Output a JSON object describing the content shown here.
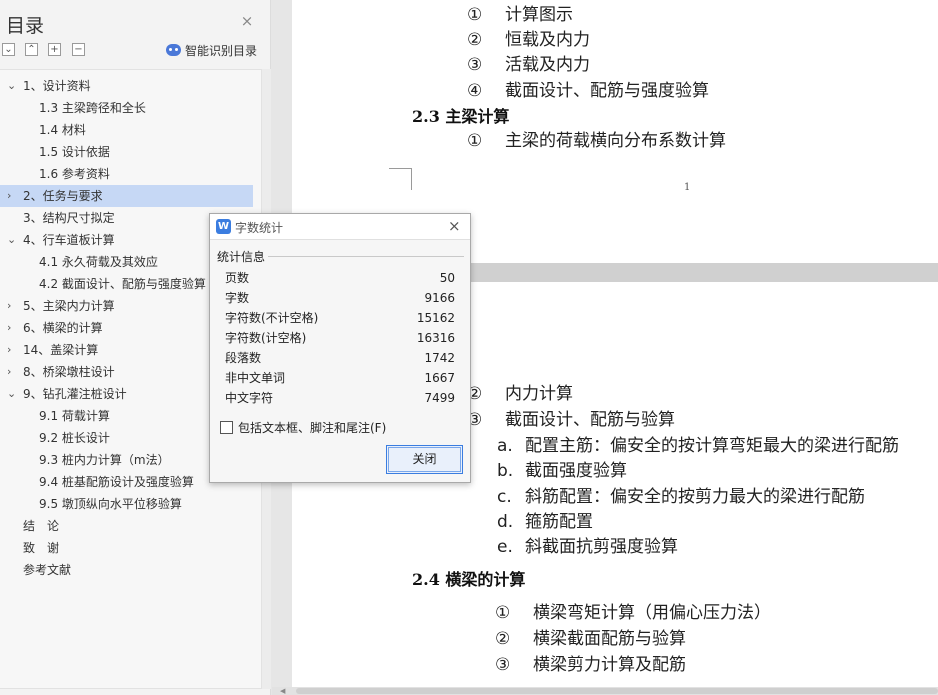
{
  "toc": {
    "title": "目录",
    "close_glyph": "×",
    "tools": {
      "collapse_all": "⌄",
      "expand_up": "⌃",
      "add": "+",
      "remove": "−",
      "smart_label": "智能识别目录"
    },
    "items": [
      {
        "label": "1、设计资料",
        "level": 1,
        "chevron": "⌄"
      },
      {
        "label": "1.3 主梁跨径和全长",
        "level": 2
      },
      {
        "label": "1.4 材料",
        "level": 2
      },
      {
        "label": "1.5 设计依据",
        "level": 2
      },
      {
        "label": "1.6 参考资料",
        "level": 2
      },
      {
        "label": "2、任务与要求",
        "level": 1,
        "chevron": "›",
        "selected": true
      },
      {
        "label": "3、结构尺寸拟定",
        "level": 1
      },
      {
        "label": "4、行车道板计算",
        "level": 1,
        "chevron": "⌄"
      },
      {
        "label": "4.1 永久荷载及其效应",
        "level": 2
      },
      {
        "label": "4.2 截面设计、配筋与强度验算",
        "level": 2
      },
      {
        "label": "5、主梁内力计算",
        "level": 1,
        "chevron": "›"
      },
      {
        "label": "6、横梁的计算",
        "level": 1,
        "chevron": "›"
      },
      {
        "label": "14、盖梁计算",
        "level": 1,
        "chevron": "›"
      },
      {
        "label": "8、桥梁墩柱设计",
        "level": 1,
        "chevron": "›"
      },
      {
        "label": "9、钻孔灌注桩设计",
        "level": 1,
        "chevron": "⌄"
      },
      {
        "label": "9.1 荷载计算",
        "level": 2
      },
      {
        "label": "9.2 桩长设计",
        "level": 2
      },
      {
        "label": "9.3 桩内力计算（m法）",
        "level": 2
      },
      {
        "label": "9.4 桩基配筋设计及强度验算",
        "level": 2
      },
      {
        "label": "9.5 墩顶纵向水平位移验算",
        "level": 2
      },
      {
        "label": "结　论",
        "level": 1
      },
      {
        "label": "致　谢",
        "level": 1
      },
      {
        "label": "参考文献",
        "level": 1
      }
    ]
  },
  "doc": {
    "page1": {
      "lines": [
        {
          "num": "①",
          "text": "计算图示"
        },
        {
          "num": "②",
          "text": "恒载及内力"
        },
        {
          "num": "③",
          "text": "活载及内力"
        },
        {
          "num": "④",
          "text": "截面设计、配筋与强度验算"
        }
      ],
      "heading": "2.3 主梁计算",
      "heading_line": {
        "num": "①",
        "text": "主梁的荷载横向分布系数计算"
      },
      "page_number": "1"
    },
    "page2": {
      "lines": [
        {
          "num": "②",
          "text": "内力计算"
        },
        {
          "num": "③",
          "text": "截面设计、配筋与验算"
        }
      ],
      "sub_items": [
        {
          "num": "a.",
          "text": "配置主筋：偏安全的按计算弯矩最大的梁进行配筋"
        },
        {
          "num": "b.",
          "text": "截面强度验算"
        },
        {
          "num": "c.",
          "text": "斜筋配置：偏安全的按剪力最大的梁进行配筋"
        },
        {
          "num": "d.",
          "text": "箍筋配置"
        },
        {
          "num": "e.",
          "text": "斜截面抗剪强度验算"
        }
      ],
      "heading": "2.4 横梁的计算",
      "heading_lines": [
        {
          "num": "①",
          "text": "横梁弯矩计算（用偏心压力法）"
        },
        {
          "num": "②",
          "text": "横梁截面配筋与验算"
        },
        {
          "num": "③",
          "text": "横梁剪力计算及配筋"
        }
      ]
    }
  },
  "dialog": {
    "icon_letter": "W",
    "title": "字数统计",
    "close_glyph": "×",
    "group_label": "统计信息",
    "stats": [
      {
        "label": "页数",
        "value": "50"
      },
      {
        "label": "字数",
        "value": "9166"
      },
      {
        "label": "字符数(不计空格)",
        "value": "15162"
      },
      {
        "label": "字符数(计空格)",
        "value": "16316"
      },
      {
        "label": "段落数",
        "value": "1742"
      },
      {
        "label": "非中文单词",
        "value": "1667"
      },
      {
        "label": "中文字符",
        "value": "7499"
      }
    ],
    "checkbox_label": "包括文本框、脚注和尾注(F)",
    "checkbox_checked": false,
    "close_button": "关闭"
  }
}
